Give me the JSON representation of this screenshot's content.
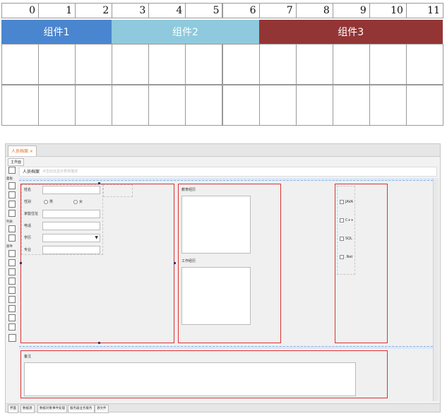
{
  "grid": {
    "columns": [
      "0",
      "1",
      "2",
      "3",
      "4",
      "5",
      "6",
      "7",
      "8",
      "9",
      "10",
      "11"
    ],
    "components": [
      {
        "label": "组件1",
        "color": "#4a86cf"
      },
      {
        "label": "组件2",
        "color": "#8ec9dd"
      },
      {
        "label": "组件3",
        "color": "#943535"
      }
    ]
  },
  "designer": {
    "doc_tab": "人员档案 ×",
    "sub_tab": "主界面",
    "title": "人员档案",
    "title_placeholder": "点击此处显示表单描述",
    "left_tool_groups": [
      "面板",
      "列表",
      "部件"
    ],
    "form": {
      "name_label": "姓名",
      "gender_label": "性别",
      "gender_options": [
        "男",
        "女"
      ],
      "address_label": "家庭住址",
      "phone_label": "电话",
      "school_label": "学历",
      "major_label": "专业",
      "edu_history_label": "教育经历",
      "work_history_label": "工作经历",
      "skills": [
        "JAVA",
        "C++",
        "SQL",
        ".Net"
      ],
      "remark_label": "备注"
    },
    "bottom_tabs": [
      "界面",
      "数据源",
      "数据对象事件处理",
      "服务器业务服务",
      "源文件"
    ]
  }
}
